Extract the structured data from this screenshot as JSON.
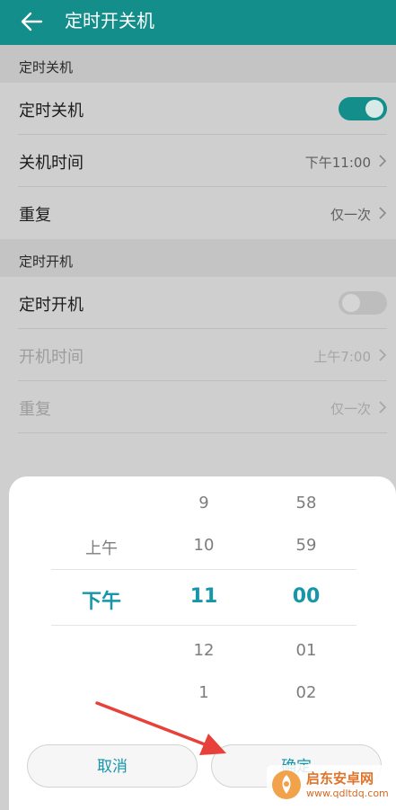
{
  "header": {
    "title": "定时开关机"
  },
  "shutdown": {
    "section_title": "定时关机",
    "toggle_label": "定时关机",
    "toggle_on": true,
    "time_label": "关机时间",
    "time_value": "下午11:00",
    "repeat_label": "重复",
    "repeat_value": "仅一次"
  },
  "startup": {
    "section_title": "定时开机",
    "toggle_label": "定时开机",
    "toggle_on": false,
    "time_label": "开机时间",
    "time_value": "上午7:00",
    "repeat_label": "重复",
    "repeat_value": "仅一次"
  },
  "picker": {
    "ampm": [
      "上午",
      "下午"
    ],
    "ampm_selected": "下午",
    "hours": [
      "9",
      "10",
      "11",
      "12",
      "1"
    ],
    "hours_selected": "11",
    "minutes": [
      "58",
      "59",
      "00",
      "01",
      "02"
    ],
    "minutes_selected": "00",
    "cancel_label": "取消",
    "confirm_label": "确定"
  },
  "watermark": {
    "name": "启东安卓网",
    "url": "www.qdltdq.com"
  },
  "colors": {
    "accent": "#138e8a",
    "picker_selected": "#1596a9",
    "arrow": "#e8403a"
  }
}
